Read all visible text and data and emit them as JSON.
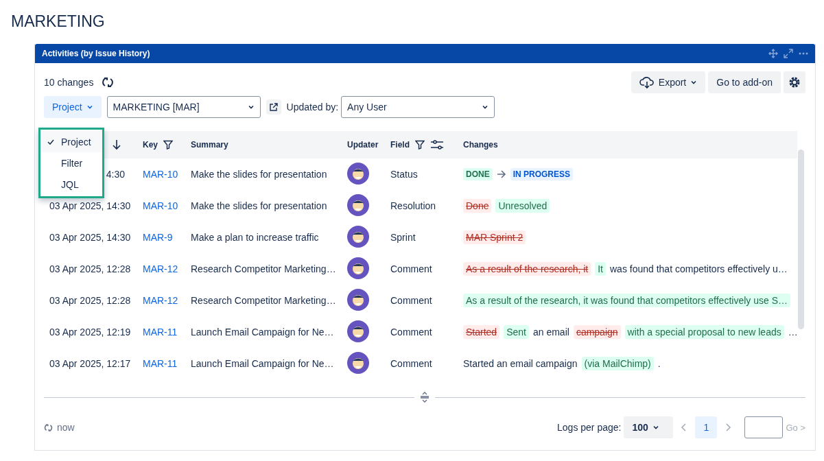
{
  "page_title": "MARKETING",
  "gadget": {
    "title": "Activities (by Issue History)"
  },
  "toolbar": {
    "count": "10 changes",
    "export": "Export",
    "addon": "Go to add-on"
  },
  "filters": {
    "source": "Project",
    "project": "MARKETING [MAR]",
    "updated_by_label": "Updated by:",
    "updated_by": "Any User"
  },
  "source_menu": [
    {
      "label": "Project",
      "selected": true
    },
    {
      "label": "Filter",
      "selected": false
    },
    {
      "label": "JQL",
      "selected": false
    }
  ],
  "columns": [
    {
      "kind": "sort"
    },
    {
      "label": "Key",
      "kind": "filter"
    },
    {
      "label": "Summary",
      "kind": "plain"
    },
    {
      "label": "Updater",
      "kind": "plain"
    },
    {
      "label": "Field",
      "kind": "filter-settings"
    },
    {
      "label": "Changes",
      "kind": "plain"
    }
  ],
  "rows": [
    {
      "date": "4:30",
      "key": "MAR-10",
      "summary": "Make the slides for presentation",
      "field": "Status",
      "changes": [
        {
          "kind": "from",
          "text": "DONE"
        },
        {
          "kind": "arrow"
        },
        {
          "kind": "to",
          "text": "IN PROGRESS"
        }
      ]
    },
    {
      "date": "03 Apr 2025, 14:30",
      "key": "MAR-10",
      "summary": "Make the slides for presentation",
      "field": "Resolution",
      "changes": [
        {
          "kind": "del",
          "text": "Done"
        },
        {
          "kind": "ins",
          "text": "Unresolved"
        }
      ]
    },
    {
      "date": "03 Apr 2025, 14:30",
      "key": "MAR-9",
      "summary": "Make a plan to increase traffic",
      "field": "Sprint",
      "changes": [
        {
          "kind": "del",
          "text": "MAR Sprint 2"
        }
      ]
    },
    {
      "date": "03 Apr 2025, 12:28",
      "key": "MAR-12",
      "summary": "Research Competitor Marketing…",
      "field": "Comment",
      "changes": [
        {
          "kind": "del",
          "text": "As a result of the research, it"
        },
        {
          "kind": "ins",
          "text": "It"
        },
        {
          "kind": "plain",
          "text": "was found that competitors effectively u…"
        }
      ]
    },
    {
      "date": "03 Apr 2025, 12:28",
      "key": "MAR-12",
      "summary": "Research Competitor Marketing…",
      "field": "Comment",
      "changes": [
        {
          "kind": "ins",
          "text": "As a result of the research, it was found that competitors effectively use S…"
        }
      ]
    },
    {
      "date": "03 Apr 2025, 12:19",
      "key": "MAR-11",
      "summary": "Launch Email Campaign for Ne…",
      "field": "Comment",
      "changes": [
        {
          "kind": "del",
          "text": "Started"
        },
        {
          "kind": "ins",
          "text": "Sent"
        },
        {
          "kind": "plain",
          "text": "an email"
        },
        {
          "kind": "del",
          "text": "campaign"
        },
        {
          "kind": "ins",
          "text": "with a special proposal to new leads"
        },
        {
          "kind": "plain",
          "text": "…"
        }
      ]
    },
    {
      "date": "03 Apr 2025, 12:17",
      "key": "MAR-11",
      "summary": "Launch Email Campaign for Ne…",
      "field": "Comment",
      "changes": [
        {
          "kind": "plain",
          "text": "Started an email campaign"
        },
        {
          "kind": "ins",
          "text": "(via MailChimp)"
        },
        {
          "kind": "plain",
          "text": "."
        }
      ]
    }
  ],
  "footer": {
    "refreshed": "now",
    "per_page_label": "Logs per page:",
    "per_page": "100",
    "pages": [
      {
        "label": "1",
        "selected": true
      }
    ],
    "go": "Go >"
  }
}
